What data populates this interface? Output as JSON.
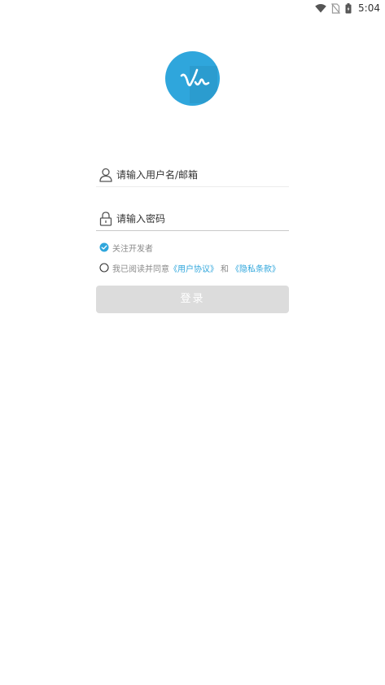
{
  "status_bar": {
    "time": "5:04",
    "icons": [
      "wifi-icon",
      "no-sim-icon",
      "battery-icon"
    ]
  },
  "logo": {
    "icon": "signature-logo-icon",
    "background_color": "#2fa6dc"
  },
  "form": {
    "username": {
      "placeholder": "请输入用户名/邮箱",
      "value": "",
      "icon": "user-icon"
    },
    "password": {
      "placeholder": "请输入密码",
      "value": "",
      "icon": "lock-icon"
    },
    "follow_developer": {
      "label": "关注开发者",
      "checked": true
    },
    "agreement": {
      "checked": false,
      "prefix": "我已阅读并同意",
      "user_agreement": "《用户协议》",
      "and": "和",
      "privacy_policy": "《隐私条款》"
    },
    "login_button": {
      "label": "登录",
      "enabled": false
    }
  },
  "colors": {
    "accent": "#2fa6dc",
    "button_disabled": "#dcdcdc",
    "secondary_text": "#8a8a8a"
  }
}
